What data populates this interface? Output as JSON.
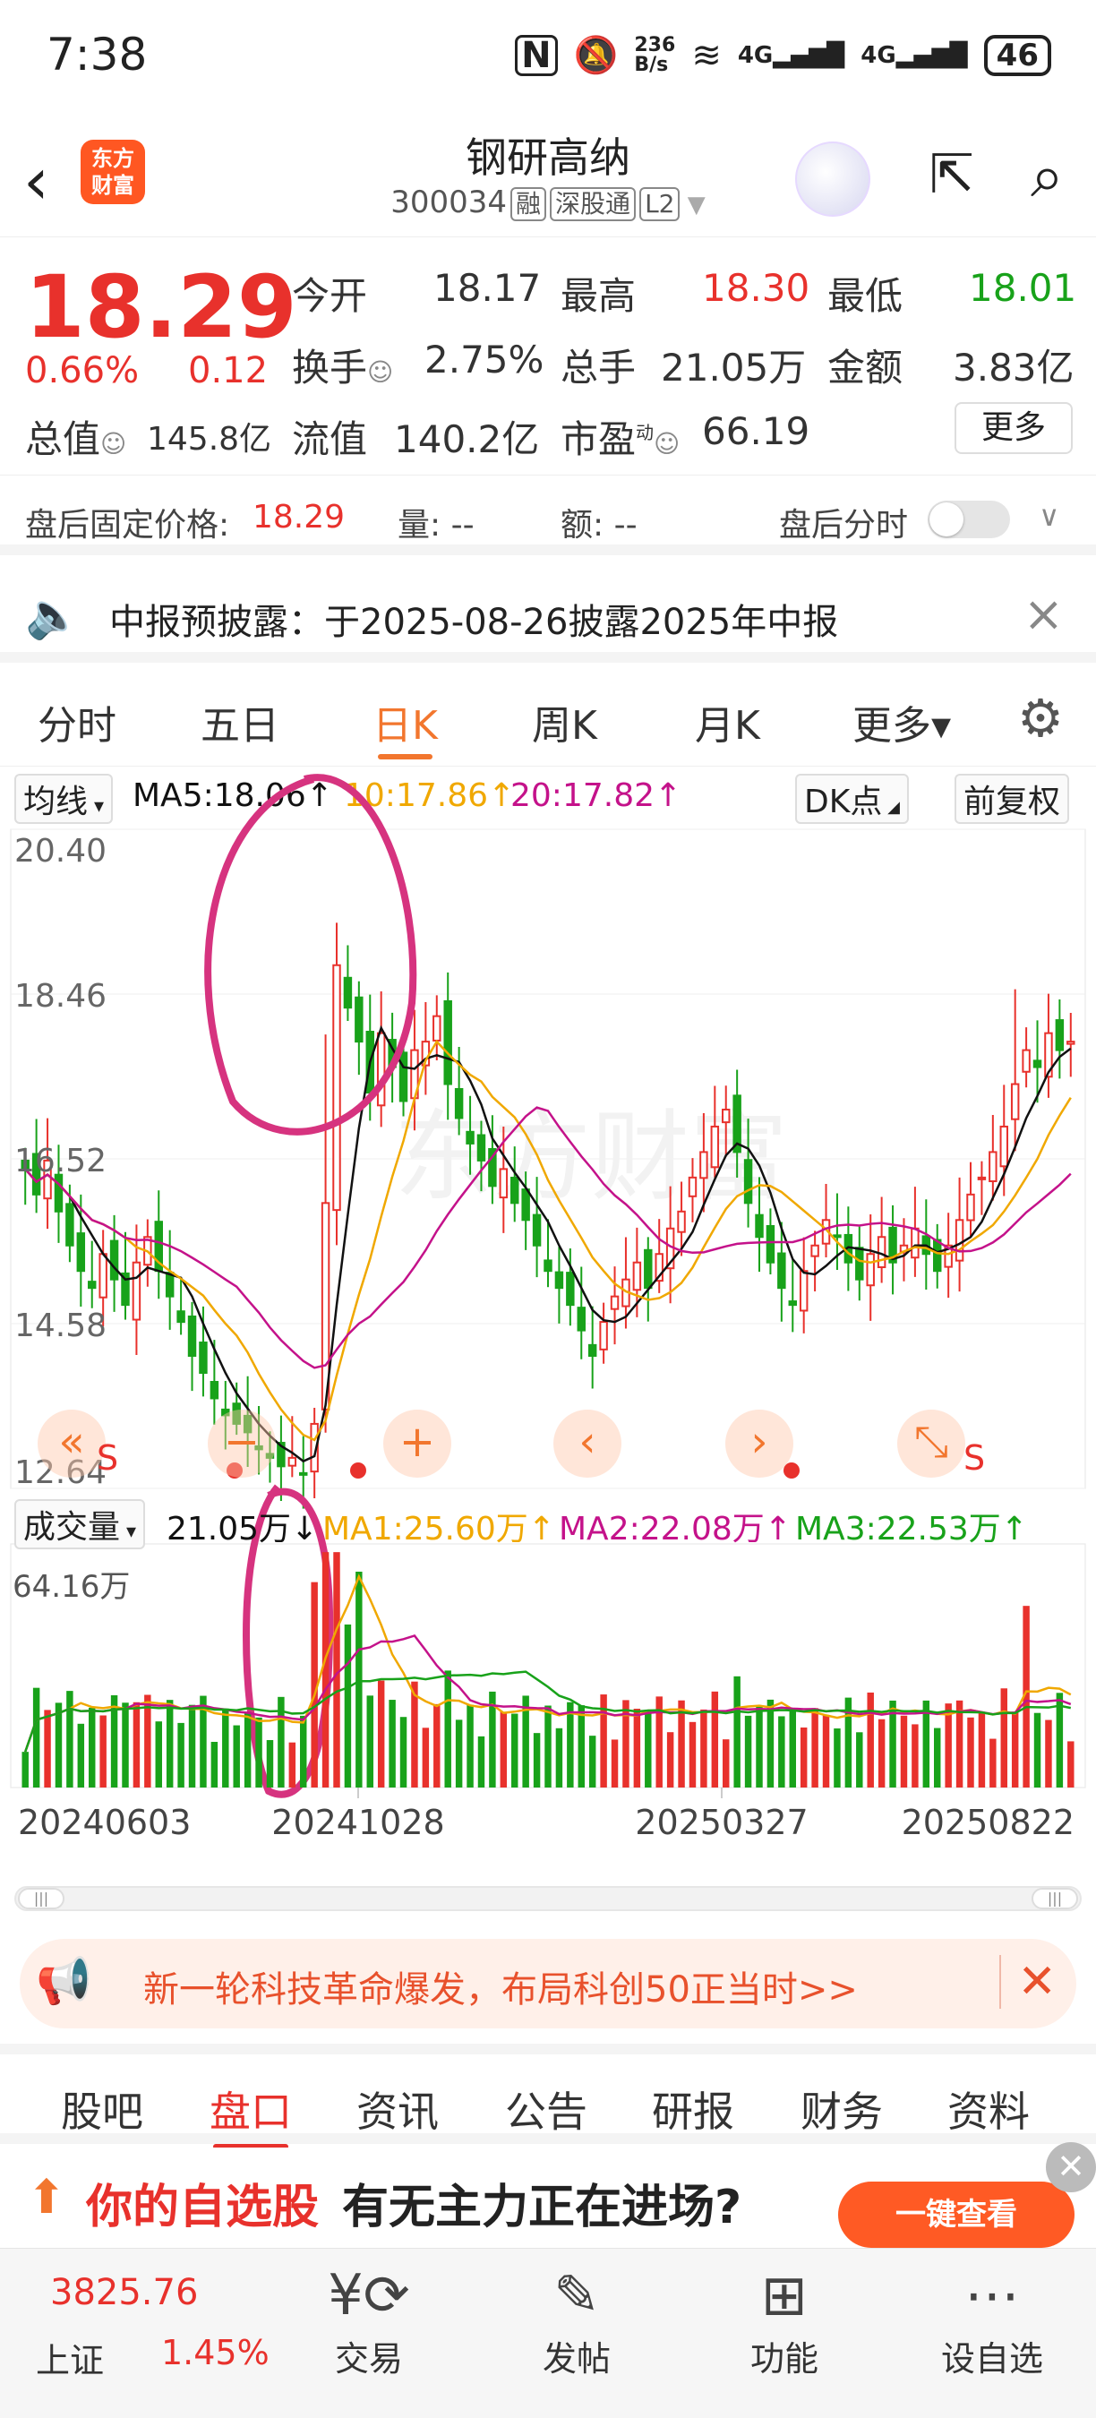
{
  "status_bar": {
    "time": "7:38",
    "net_speed": "236\nB/s",
    "net_speed_top": "236",
    "net_speed_bottom": "B/s",
    "signal1": "4G",
    "signal2": "4G",
    "battery": "46",
    "icons": [
      "nfc-icon",
      "mute-icon",
      "wifi-icon",
      "signal-icon",
      "battery-icon"
    ]
  },
  "header": {
    "logo_line1": "东方",
    "logo_line2": "财富",
    "stock_name": "钢研高纳",
    "stock_code": "300034",
    "tag_margin": "融",
    "tag_connect": "深股通",
    "tag_level": "L2"
  },
  "quote": {
    "price": "18.29",
    "change_pct": "0.66%",
    "change_abs": "0.12",
    "open_label": "今开",
    "open": "18.17",
    "high_label": "最高",
    "high": "18.30",
    "low_label": "最低",
    "low": "18.01",
    "turnover_label": "换手",
    "turnover": "2.75%",
    "volume_label": "总手",
    "volume": "21.05万",
    "amount_label": "金额",
    "amount": "3.83亿",
    "mktcap_label": "总值",
    "mktcap": "145.8亿",
    "float_label": "流值",
    "float": "140.2亿",
    "pe_label": "市盈",
    "pe_sup": "动",
    "pe": "66.19",
    "more": "更多"
  },
  "after_hours": {
    "label": "盘后固定价格:",
    "price": "18.29",
    "vol_label": "量: --",
    "amt_label": "额: --",
    "timeshare": "盘后分时"
  },
  "notice": {
    "text": "中报预披露：于2025-08-26披露2025年中报"
  },
  "tabs": [
    "分时",
    "五日",
    "日K",
    "周K",
    "月K",
    "更多▾"
  ],
  "active_tab": 2,
  "ma_bar": {
    "select": "均线",
    "ma5": "MA5:18.06↑",
    "ma10": "10:17.86↑",
    "ma20": "20:17.82↑",
    "dk": "DK点",
    "adjust": "前复权"
  },
  "price_axis": [
    "20.40",
    "18.46",
    "16.52",
    "14.58",
    "12.64"
  ],
  "vol_bar": {
    "select": "成交量",
    "current": "21.05万↓",
    "ma1": "MA1:25.60万↑",
    "ma2": "MA2:22.08万↑",
    "ma3": "MA3:22.53万↑",
    "axis_top": "64.16万"
  },
  "date_axis": [
    "20240603",
    "20241028",
    "20250327",
    "20250822"
  ],
  "controls": [
    "«",
    "−",
    "+",
    "‹",
    "›",
    "⤡"
  ],
  "signal_s": "S",
  "watermark": "东方财富",
  "promo": {
    "text": "新一轮科技革命爆发，布局科创50正当时>>"
  },
  "bottom_tabs": [
    "股吧",
    "盘口",
    "资讯",
    "公告",
    "研报",
    "财务",
    "资料"
  ],
  "active_bottom_tab": 1,
  "ad": {
    "part1": "你的自选股",
    "part2": "有无主力正在进场?",
    "button": "一键查看"
  },
  "bottom_nav": {
    "index_value": "3825.76",
    "index_name": "上证",
    "index_pct": "1.45%",
    "items": [
      {
        "label": "交易",
        "icon": "yen-exchange-icon"
      },
      {
        "label": "发帖",
        "icon": "edit-icon"
      },
      {
        "label": "功能",
        "icon": "grid-icon"
      },
      {
        "label": "设自选",
        "icon": "more-dots-icon"
      }
    ]
  },
  "colors": {
    "up": "#e8312c",
    "down": "#18a21a",
    "accent": "#f2762e",
    "ma5": "#111111",
    "ma10": "#f0a800",
    "ma20": "#c4128a"
  },
  "chart_data": {
    "type": "candlestick",
    "x_ticks": [
      "20240603",
      "20241028",
      "20250327",
      "20250822"
    ],
    "ylim": [
      12.64,
      20.4
    ],
    "y_ticks": [
      20.4,
      18.46,
      16.52,
      14.58,
      12.64
    ],
    "close": [
      16.4,
      16.1,
      16.5,
      15.9,
      15.5,
      15.2,
      15.0,
      15.4,
      15.1,
      14.8,
      15.3,
      15.6,
      15.2,
      14.9,
      14.6,
      14.2,
      14.0,
      13.7,
      13.5,
      13.4,
      13.3,
      13.1,
      13.0,
      12.9,
      13.0,
      12.8,
      13.4,
      16.0,
      18.8,
      18.3,
      17.9,
      17.3,
      18.0,
      17.6,
      17.2,
      17.8,
      17.9,
      18.2,
      17.4,
      17.0,
      16.7,
      16.5,
      16.2,
      16.4,
      16.0,
      15.8,
      15.5,
      15.2,
      15.0,
      14.8,
      14.5,
      14.2,
      14.6,
      14.9,
      15.1,
      15.3,
      15.0,
      15.4,
      15.7,
      15.9,
      16.3,
      16.6,
      16.9,
      17.1,
      16.6,
      16.0,
      15.6,
      15.3,
      15.0,
      14.8,
      15.2,
      15.5,
      15.8,
      15.6,
      15.3,
      15.1,
      15.4,
      15.6,
      15.3,
      15.5,
      15.7,
      15.4,
      15.2,
      15.5,
      15.8,
      16.1,
      16.3,
      16.6,
      16.9,
      17.4,
      17.8,
      17.6,
      18.0,
      17.8,
      17.9
    ],
    "volume_ylim": [
      0,
      64.16
    ],
    "volume_unit": "万"
  }
}
